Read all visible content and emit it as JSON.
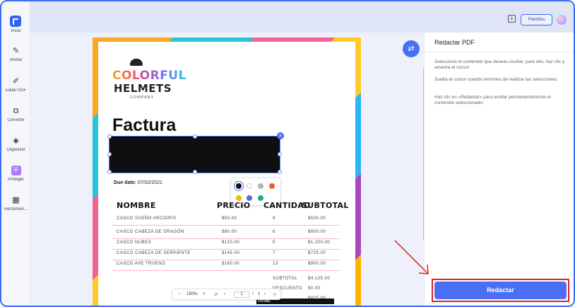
{
  "rail": {
    "items": [
      {
        "label": "Inicio",
        "icon": "home-icon"
      },
      {
        "label": "Anotar",
        "icon": "annotate-icon"
      },
      {
        "label": "Editar PDF",
        "icon": "edit-pdf-icon"
      },
      {
        "label": "Convertir",
        "icon": "convert-icon"
      },
      {
        "label": "Organizar",
        "icon": "organize-icon"
      },
      {
        "label": "Proteger",
        "icon": "protect-icon"
      },
      {
        "label": "Herramien...",
        "icon": "tools-icon"
      }
    ]
  },
  "topbar": {
    "templates_label": "Plantillas"
  },
  "document": {
    "brand_line1": "COLORFUL",
    "brand_line2": "HELMETS",
    "brand_line3": "COMPANY",
    "title": "Factura",
    "due_label": "Due date:",
    "due_value": "07/02/2021",
    "headers": {
      "name": "NOMBRE",
      "price": "PRECIO",
      "qty": "CANTIDAD",
      "subtotal": "SUBTOTAL"
    },
    "rows": [
      {
        "name": "CASCO SUEÑO ARCOÍRIS",
        "price": "$50.00",
        "qty": "9",
        "subtotal": "$500.00"
      },
      {
        "name": "CASCO CABEZA DE DRAGÓN",
        "price": "$80.00",
        "qty": "6",
        "subtotal": "$800.00"
      },
      {
        "name": "CASCO NUBES",
        "price": "$120.00",
        "qty": "5",
        "subtotal": "$1.200.00"
      },
      {
        "name": "CASCO CABEZA DE SERPIENTE",
        "price": "$145.00",
        "qty": "7",
        "subtotal": "$725.00"
      },
      {
        "name": "CASCO AVE TRUENO",
        "price": "$180.00",
        "qty": "13",
        "subtotal": "$900.00"
      }
    ],
    "summary": {
      "subtotal_label": "SUBTOTAL",
      "subtotal_value": "$4.125.00",
      "discount_label": "DESCUENTO",
      "discount_value": "$0.00",
      "after_value": "$825.00",
      "total_label": "TOTAL"
    }
  },
  "palette": {
    "colors": [
      "#111111",
      "#ffffff",
      "#b5b5b5",
      "#f05a24",
      "#f6b614",
      "#4a6ff5",
      "#19b36b"
    ]
  },
  "zoombar": {
    "minus": "−",
    "zoom": "150%",
    "plus": "+",
    "first": "⊬",
    "prev": "‹",
    "page": "1",
    "sep": "/",
    "total": "1",
    "next": "›",
    "last": "⊣"
  },
  "panel": {
    "title": "Redactar PDF",
    "p1": "Selecciona el contenido que deseas ocultar; para ello, haz clic y arrastra el cursor.",
    "p2": "Suelta el cursor cuando termines de realizar las selecciones.",
    "p3": "Haz clic en «Redactar» para ocultar permanentemente el contenido seleccionado.",
    "redact_button": "Redactar"
  }
}
